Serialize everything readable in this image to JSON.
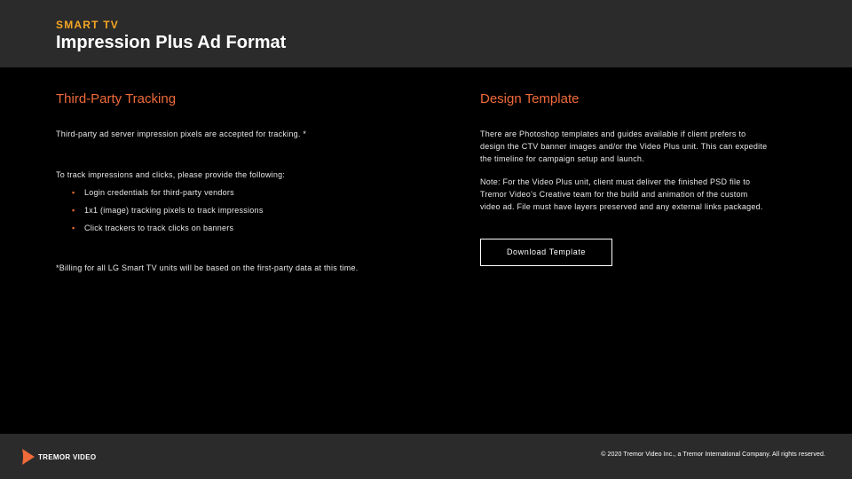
{
  "header": {
    "eyebrow": "SMART TV",
    "title": "Impression Plus Ad Format"
  },
  "left": {
    "heading": "Third-Party Tracking",
    "paragraph1": "Third-party ad server impression pixels are accepted for tracking. *",
    "paragraph2": "To track impressions and clicks, please provide the following:",
    "bullets": [
      "Login credentials for third-party vendors",
      "1x1 (image) tracking pixels to track impressions",
      "Click trackers to track clicks on banners"
    ],
    "footnote": "*Billing for all LG Smart TV units will be based on the first-party data at this time."
  },
  "right": {
    "heading": "Design Template",
    "paragraph1_lines": [
      "There are Photoshop templates and guides available if client prefers to",
      "design the CTV banner images and/or the Video Plus unit. This can expedite",
      "the timeline for campaign setup and launch."
    ],
    "paragraph2_lines": [
      "Note: For the Video Plus unit, client must deliver the finished PSD file to",
      "Tremor Video’s Creative team for the build and animation of the custom",
      "video ad. File must have layers preserved and any external links packaged."
    ],
    "button_label": "Download Template"
  },
  "footer": {
    "logo_text": "TREMOR VIDEO",
    "copyright": "© 2020 Tremor Video Inc., a Tremor International Company. All rights reserved."
  },
  "colors": {
    "accent_orange": "#f06a3a",
    "eyebrow_gold": "#f5a623",
    "bar_gray": "#2b2b2b",
    "background": "#000000"
  },
  "icons": {
    "logo_mark": "tremor-play-icon",
    "bullet": "square-bullet"
  }
}
